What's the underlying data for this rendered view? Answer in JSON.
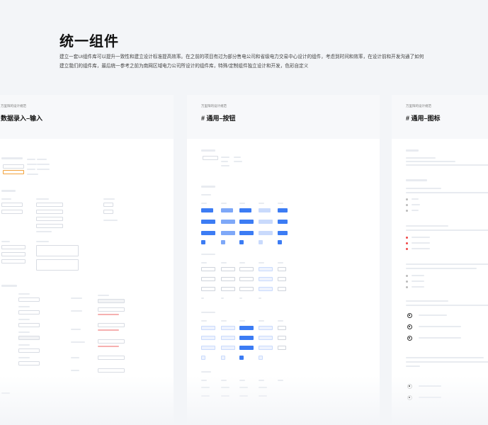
{
  "page": {
    "title": "统一组件",
    "description": "建立一套UI组件库可以提升一致性和建立设计标准提高效率。在之前的项目有过为部分售电公司和省级电力交易中心设计的组件，考虑到时间和效率，在设计前和开发沟通了如何建立我们的组件库，最后统一参考之前为南网区域电力公司所设计的组件库，特殊/定制组件独立设计和开发，色彩自定义"
  },
  "cards": [
    {
      "kicker": "万里阳的设计规范",
      "title": "数据录入–输入"
    },
    {
      "kicker": "万里阳的设计规范",
      "title": "# 通用–按钮"
    },
    {
      "kicker": "万里阳的设计规范",
      "title": "# 通用–图标"
    }
  ],
  "colors": {
    "accent": "#3c7cf4",
    "accent_light": "#7ea8f8",
    "danger": "#f04848"
  }
}
